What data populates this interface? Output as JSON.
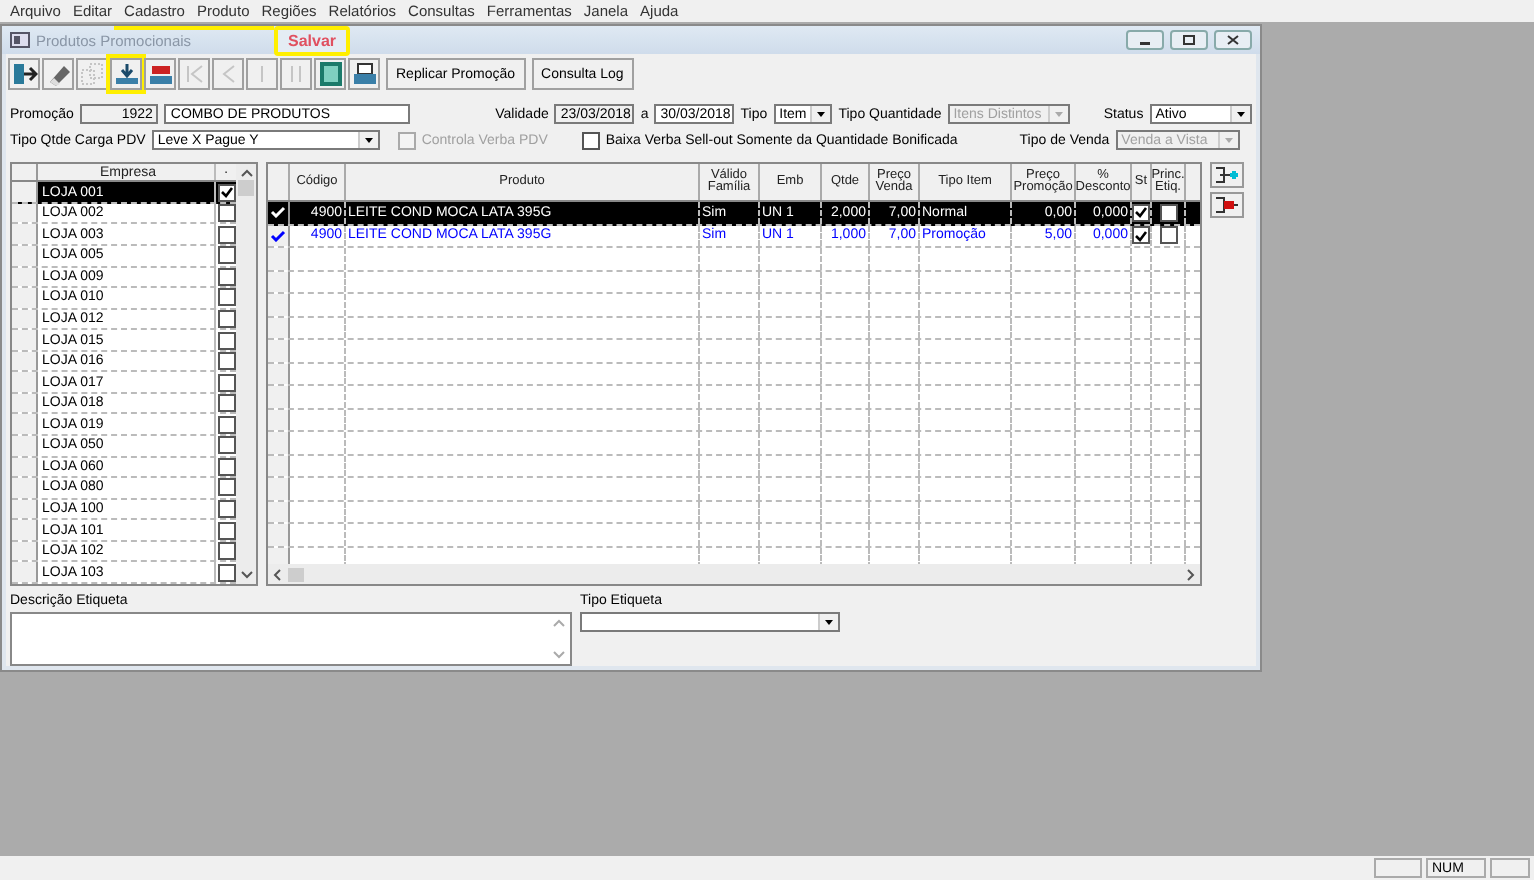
{
  "menu": [
    "Arquivo",
    "Editar",
    "Cadastro",
    "Produto",
    "Regiões",
    "Relatórios",
    "Consultas",
    "Ferramentas",
    "Janela",
    "Ajuda"
  ],
  "window": {
    "title": "Produtos Promocionais"
  },
  "callout": {
    "label": "Salvar"
  },
  "toolbar": [
    {
      "kind": "exit",
      "disabled": false,
      "highlighted": false
    },
    {
      "kind": "eraser",
      "disabled": false,
      "highlighted": false
    },
    {
      "kind": "copy",
      "disabled": true,
      "highlighted": false
    },
    {
      "kind": "save",
      "disabled": false,
      "highlighted": true
    },
    {
      "kind": "tray",
      "disabled": false,
      "highlighted": false
    },
    {
      "kind": "first",
      "disabled": true,
      "highlighted": false
    },
    {
      "kind": "prev",
      "disabled": true,
      "highlighted": false
    },
    {
      "kind": "next",
      "disabled": true,
      "highlighted": false
    },
    {
      "kind": "last",
      "disabled": true,
      "highlighted": false
    },
    {
      "kind": "film",
      "disabled": false,
      "highlighted": false
    },
    {
      "kind": "print",
      "disabled": false,
      "highlighted": false
    }
  ],
  "toolbar_buttons": [
    "Replicar Promoção",
    "Consulta Log"
  ],
  "form": {
    "promocao_label": "Promoção",
    "promocao_code": "1922",
    "promocao_name": "COMBO DE PRODUTOS",
    "validade_label": "Validade",
    "validade_from": "23/03/2018",
    "a_label": "a",
    "validade_to": "30/03/2018",
    "tipo_label": "Tipo",
    "tipo": "Item",
    "tipo_quantidade_label": "Tipo Quantidade",
    "tipo_quantidade": "Itens Distintos",
    "status_label": "Status",
    "status": "Ativo",
    "tipo_qtde_carga_label": "Tipo Qtde Carga PDV",
    "tipo_qtde_carga": "Leve X Pague Y",
    "controla_verba": {
      "label": "Controla Verba PDV",
      "checked": false,
      "disabled": true
    },
    "baixa_verba": {
      "label": "Baixa Verba Sell-out Somente da Quantidade Bonificada",
      "checked": false,
      "disabled": false
    },
    "tipo_venda_label": "Tipo de Venda",
    "tipo_venda": "Venda a Vista"
  },
  "stores": {
    "columns": [
      "Empresa",
      "·"
    ],
    "rows": [
      {
        "name": "LOJA 001",
        "checked": true,
        "selected": true
      },
      {
        "name": "LOJA 002",
        "checked": false,
        "selected": false
      },
      {
        "name": "LOJA 003",
        "checked": false,
        "selected": false
      },
      {
        "name": "LOJA 005",
        "checked": false,
        "selected": false
      },
      {
        "name": "LOJA 009",
        "checked": false,
        "selected": false
      },
      {
        "name": "LOJA 010",
        "checked": false,
        "selected": false
      },
      {
        "name": "LOJA 012",
        "checked": false,
        "selected": false
      },
      {
        "name": "LOJA 015",
        "checked": false,
        "selected": false
      },
      {
        "name": "LOJA 016",
        "checked": false,
        "selected": false
      },
      {
        "name": "LOJA 017",
        "checked": false,
        "selected": false
      },
      {
        "name": "LOJA 018",
        "checked": false,
        "selected": false
      },
      {
        "name": "LOJA 019",
        "checked": false,
        "selected": false
      },
      {
        "name": "LOJA 050",
        "checked": false,
        "selected": false
      },
      {
        "name": "LOJA 060",
        "checked": false,
        "selected": false
      },
      {
        "name": "LOJA 080",
        "checked": false,
        "selected": false
      },
      {
        "name": "LOJA 100",
        "checked": false,
        "selected": false
      },
      {
        "name": "LOJA 101",
        "checked": false,
        "selected": false
      },
      {
        "name": "LOJA 102",
        "checked": false,
        "selected": false
      },
      {
        "name": "LOJA 103",
        "checked": false,
        "selected": false
      }
    ]
  },
  "products": {
    "columns": [
      "Código",
      "Produto",
      "Válido Família",
      "Emb",
      "Qtde",
      "Preço Venda",
      "Tipo Item",
      "Preço Promoção",
      "% Desconto",
      "St",
      "Princ. Etiq."
    ],
    "rows": [
      {
        "codigo": "4900",
        "produto": "LEITE COND MOCA LATA 395G",
        "valido_familia": "Sim",
        "emb": "UN  1",
        "qtde": "2,000",
        "preco_venda": "7,00",
        "tipo_item": "Normal",
        "preco_promocao": "0,00",
        "desconto": "0,000",
        "st": true,
        "princ_etiq": false,
        "selected": true
      },
      {
        "codigo": "4900",
        "produto": "LEITE COND MOCA LATA 395G",
        "valido_familia": "Sim",
        "emb": "UN  1",
        "qtde": "1,000",
        "preco_venda": "7,00",
        "tipo_item": "Promoção",
        "preco_promocao": "5,00",
        "desconto": "0,000",
        "st": true,
        "princ_etiq": false,
        "selected": false,
        "color": "#0000ff"
      }
    ]
  },
  "descricao_etiqueta_label": "Descrição Etiqueta",
  "tipo_etiqueta_label": "Tipo Etiqueta",
  "status_bar": {
    "num": "NUM"
  }
}
